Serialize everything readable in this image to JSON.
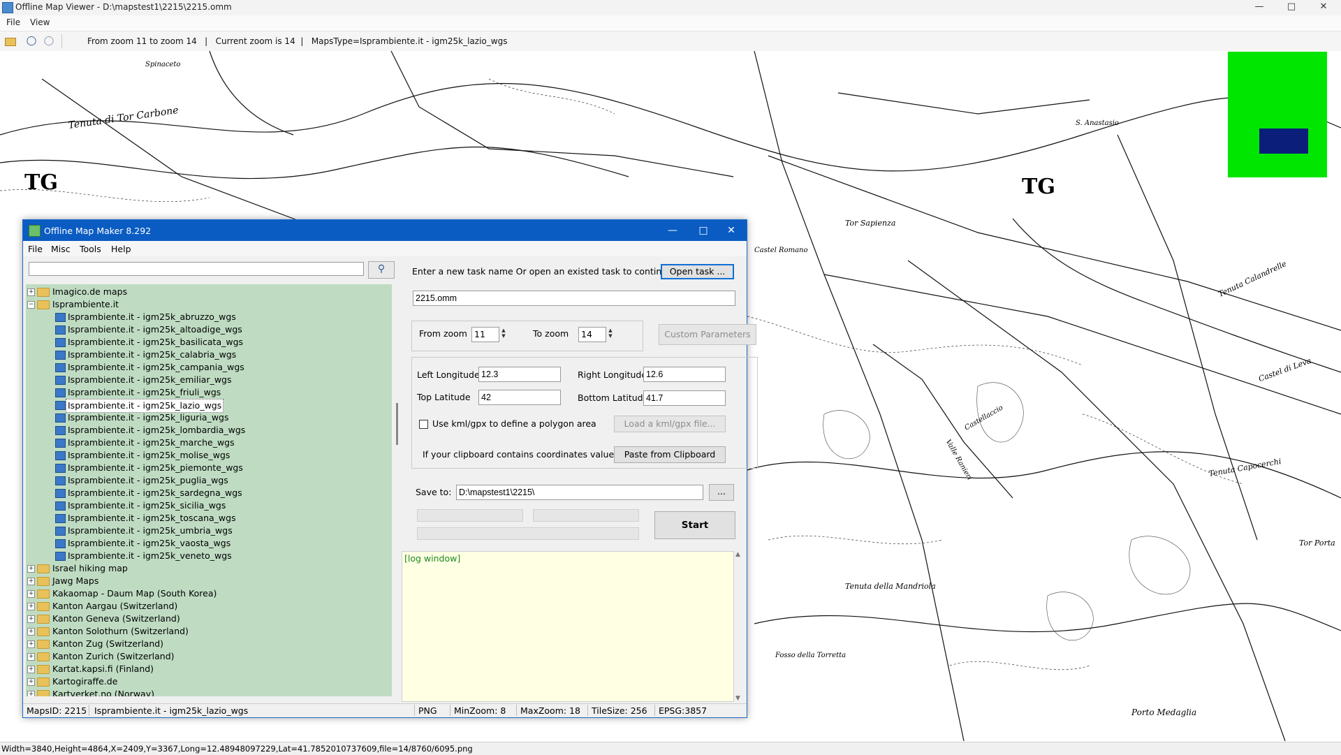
{
  "viewer": {
    "title": "Offline Map Viewer - D:\\mapstest1\\2215\\2215.omm",
    "menu": [
      "File",
      "View"
    ],
    "toolbar_status": "From zoom 11 to zoom 14   |   Current zoom is 14  |   MapsType=Isprambiente.it - igm25k_lazio_wgs",
    "statusbar": "Width=3840,Height=4864,X=2409,Y=3367,Long=12.48948097229,Lat=41.7852010737609,file=14/8760/6095.png",
    "map_labels": [
      {
        "text": "TG"
      },
      {
        "text": "TG"
      },
      {
        "text": "Tenuta di Tor Carbone"
      },
      {
        "text": "Spinaceto"
      },
      {
        "text": "Tor Sapienza"
      },
      {
        "text": "Tenuta Calandrelle"
      },
      {
        "text": "Castel di Leva"
      },
      {
        "text": "Tenuta della Mandriola"
      },
      {
        "text": "Fosso della Torretta"
      },
      {
        "text": "Tenuta Capocerchi"
      },
      {
        "text": "Tor Porta"
      },
      {
        "text": "Castel Romano"
      },
      {
        "text": "Porto Medaglia"
      },
      {
        "text": "Castellaccio"
      },
      {
        "text": "S. Anastasio"
      },
      {
        "text": "Valle Ranieri"
      }
    ],
    "colors": {
      "overview_bg": "#00e600",
      "overview_rect": "#0a1e7a"
    }
  },
  "dialog": {
    "title": "Offline Map Maker 8.292",
    "menu": [
      "File",
      "Misc",
      "Tools",
      "Help"
    ],
    "search": {
      "value": "",
      "placeholder": ""
    },
    "tree": [
      {
        "label": "Imagico.de maps",
        "type": "folder",
        "expanded": false,
        "level": 0
      },
      {
        "label": "Isprambiente.it",
        "type": "folder",
        "expanded": true,
        "level": 0
      },
      {
        "label": "Isprambiente.it - igm25k_abruzzo_wgs",
        "type": "map",
        "level": 1
      },
      {
        "label": "Isprambiente.it - igm25k_altoadige_wgs",
        "type": "map",
        "level": 1
      },
      {
        "label": "Isprambiente.it - igm25k_basilicata_wgs",
        "type": "map",
        "level": 1
      },
      {
        "label": "Isprambiente.it - igm25k_calabria_wgs",
        "type": "map",
        "level": 1
      },
      {
        "label": "Isprambiente.it - igm25k_campania_wgs",
        "type": "map",
        "level": 1
      },
      {
        "label": "Isprambiente.it - igm25k_emiliar_wgs",
        "type": "map",
        "level": 1
      },
      {
        "label": "Isprambiente.it - igm25k_friuli_wgs",
        "type": "map",
        "level": 1
      },
      {
        "label": "Isprambiente.it - igm25k_lazio_wgs",
        "type": "map",
        "level": 1,
        "selected": true
      },
      {
        "label": "Isprambiente.it - igm25k_liguria_wgs",
        "type": "map",
        "level": 1
      },
      {
        "label": "Isprambiente.it - igm25k_lombardia_wgs",
        "type": "map",
        "level": 1
      },
      {
        "label": "Isprambiente.it - igm25k_marche_wgs",
        "type": "map",
        "level": 1
      },
      {
        "label": "Isprambiente.it - igm25k_molise_wgs",
        "type": "map",
        "level": 1
      },
      {
        "label": "Isprambiente.it - igm25k_piemonte_wgs",
        "type": "map",
        "level": 1
      },
      {
        "label": "Isprambiente.it - igm25k_puglia_wgs",
        "type": "map",
        "level": 1
      },
      {
        "label": "Isprambiente.it - igm25k_sardegna_wgs",
        "type": "map",
        "level": 1
      },
      {
        "label": "Isprambiente.it - igm25k_sicilia_wgs",
        "type": "map",
        "level": 1
      },
      {
        "label": "Isprambiente.it - igm25k_toscana_wgs",
        "type": "map",
        "level": 1
      },
      {
        "label": "Isprambiente.it - igm25k_umbria_wgs",
        "type": "map",
        "level": 1
      },
      {
        "label": "Isprambiente.it - igm25k_vaosta_wgs",
        "type": "map",
        "level": 1
      },
      {
        "label": "Isprambiente.it - igm25k_veneto_wgs",
        "type": "map",
        "level": 1
      },
      {
        "label": "Israel hiking map",
        "type": "folder",
        "expanded": false,
        "level": 0
      },
      {
        "label": "Jawg Maps",
        "type": "folder",
        "expanded": false,
        "level": 0
      },
      {
        "label": "Kakaomap - Daum Map (South Korea)",
        "type": "folder",
        "expanded": false,
        "level": 0
      },
      {
        "label": "Kanton Aargau (Switzerland)",
        "type": "folder",
        "expanded": false,
        "level": 0
      },
      {
        "label": "Kanton Geneva (Switzerland)",
        "type": "folder",
        "expanded": false,
        "level": 0
      },
      {
        "label": "Kanton Solothurn (Switzerland)",
        "type": "folder",
        "expanded": false,
        "level": 0
      },
      {
        "label": "Kanton Zug (Switzerland)",
        "type": "folder",
        "expanded": false,
        "level": 0
      },
      {
        "label": "Kanton Zurich (Switzerland)",
        "type": "folder",
        "expanded": false,
        "level": 0
      },
      {
        "label": "Kartat.kapsi.fi (Finland)",
        "type": "folder",
        "expanded": false,
        "level": 0
      },
      {
        "label": "Kartogiraffe.de",
        "type": "folder",
        "expanded": false,
        "level": 0
      },
      {
        "label": "Kartverket.no (Norway)",
        "type": "folder",
        "expanded": false,
        "level": 0
      }
    ],
    "task": {
      "prompt": "Enter a new task name Or open an existed task to continue:",
      "open_label": "Open task ...",
      "name": "2215.omm"
    },
    "zoom": {
      "from_label": "From zoom",
      "from_value": "11",
      "to_label": "To zoom",
      "to_value": "14",
      "custom_label": "Custom Parameters"
    },
    "coords": {
      "left_lon_label": "Left Longitude",
      "left_lon": "12.3",
      "right_lon_label": "Right Longitude",
      "right_lon": "12.6",
      "top_lat_label": "Top Latitude",
      "top_lat": "42",
      "bottom_lat_label": "Bottom Latitude",
      "bottom_lat": "41.7",
      "kml_label": "Use kml/gpx to define a polygon area",
      "kml_button": "Load a kml/gpx file...",
      "clipboard_label": "If your clipboard contains coordinates values:",
      "clipboard_button": "Paste from Clipboard"
    },
    "save": {
      "label": "Save to:",
      "path": "D:\\mapstest1\\2215\\",
      "browse": "..."
    },
    "start_label": "Start",
    "log_text": "[log window]",
    "status": {
      "maps_id": "MapsID: 2215",
      "maps_name": "Isprambiente.it - igm25k_lazio_wgs",
      "format": "PNG",
      "min_zoom": "MinZoom: 8",
      "max_zoom": "MaxZoom: 18",
      "tile_size": "TileSize: 256",
      "epsg": "EPSG:3857"
    }
  }
}
